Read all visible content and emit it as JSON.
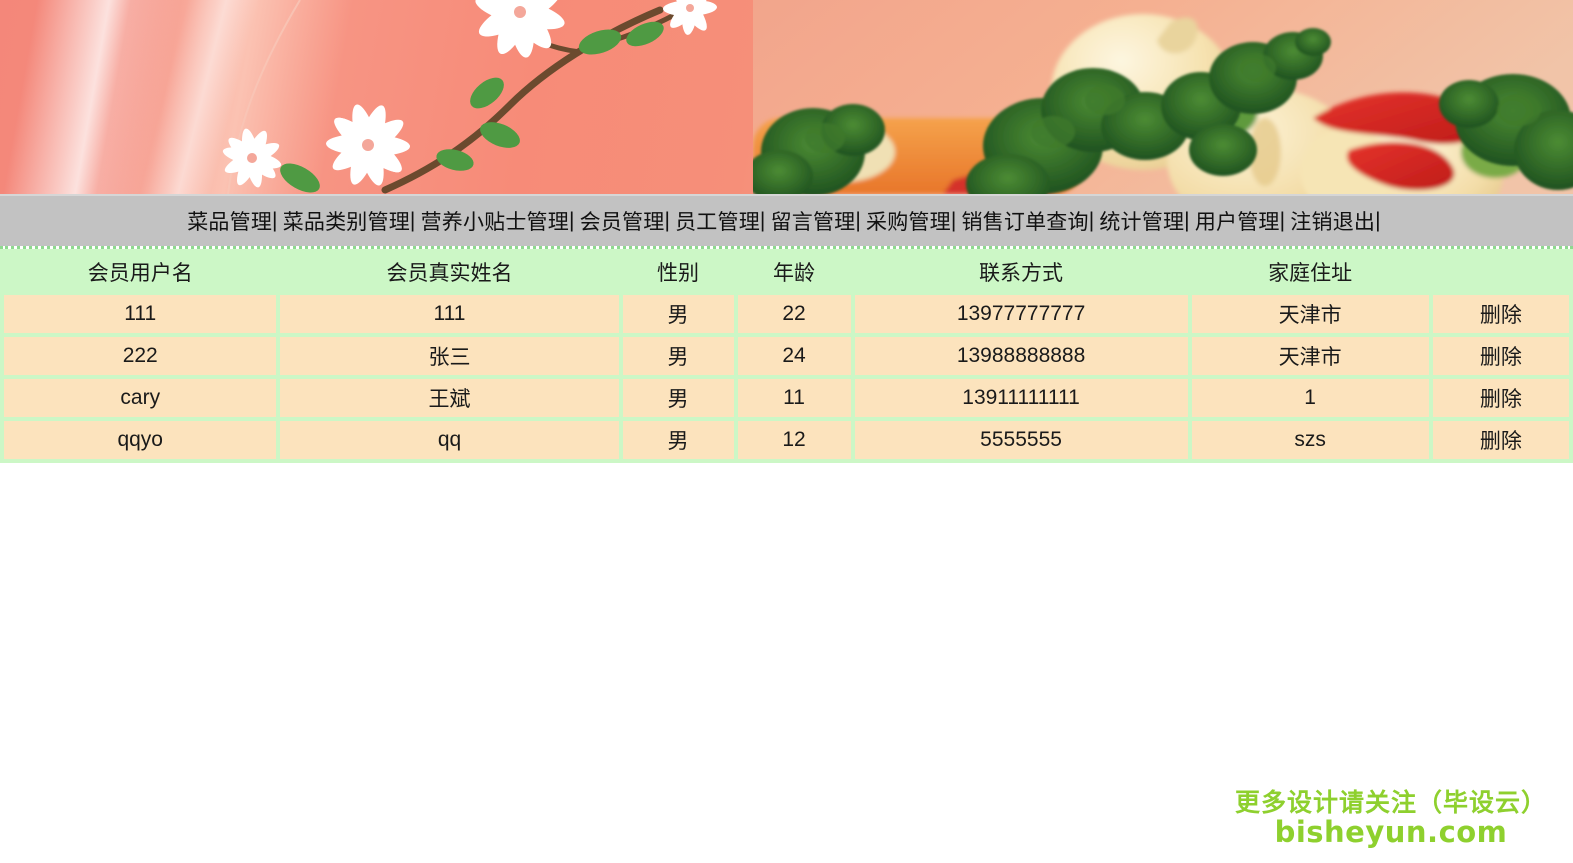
{
  "banner": {
    "alt": "vegetable-and-flower-banner",
    "colors": {
      "left_gradient_start": "#f4877a",
      "right_gradient_end": "#f0c2a6",
      "flower_petal": "#ffffff",
      "leaf": "#4f9a43",
      "stem": "#6b4a2e"
    }
  },
  "nav": {
    "separator": "|",
    "items": [
      {
        "label": "菜品管理",
        "name": "dish-management"
      },
      {
        "label": "菜品类别管理",
        "name": "dish-category-management"
      },
      {
        "label": "营养小贴士管理",
        "name": "nutrition-tips-management"
      },
      {
        "label": "会员管理",
        "name": "member-management"
      },
      {
        "label": "员工管理",
        "name": "staff-management"
      },
      {
        "label": "留言管理",
        "name": "message-management"
      },
      {
        "label": "采购管理",
        "name": "purchase-management"
      },
      {
        "label": "销售订单查询",
        "name": "sales-order-query"
      },
      {
        "label": "统计管理",
        "name": "statistics-management"
      },
      {
        "label": "用户管理",
        "name": "user-management"
      },
      {
        "label": "注销退出",
        "name": "logout"
      }
    ]
  },
  "table": {
    "headers": [
      "会员用户名",
      "会员真实姓名",
      "性别",
      "年龄",
      "联系方式",
      "家庭住址",
      ""
    ],
    "action_label": "删除",
    "rows": [
      {
        "username": "111",
        "realname": "111",
        "gender": "男",
        "age": "22",
        "phone": "13977777777",
        "address": "天津市",
        "action": "删除"
      },
      {
        "username": "222",
        "realname": "张三",
        "gender": "男",
        "age": "24",
        "phone": "13988888888",
        "address": "天津市",
        "action": "删除"
      },
      {
        "username": "cary",
        "realname": "王斌",
        "gender": "男",
        "age": "11",
        "phone": "13911111111",
        "address": "1",
        "action": "删除"
      },
      {
        "username": "qqyo",
        "realname": "qq",
        "gender": "男",
        "age": "12",
        "phone": "5555555",
        "address": "szs",
        "action": "删除"
      }
    ]
  },
  "watermark": {
    "line1": "更多设计请关注（毕设云）",
    "line2": "bisheyun.com",
    "color": "#8ed02e"
  },
  "colors": {
    "nav_background": "#c2c2c2",
    "table_grid": "#ccf7c6",
    "header_cell": "#ccf7c6",
    "data_cell": "#fce3bd",
    "text": "#1a1a1a",
    "dotted_rule": "#8fd98f"
  }
}
